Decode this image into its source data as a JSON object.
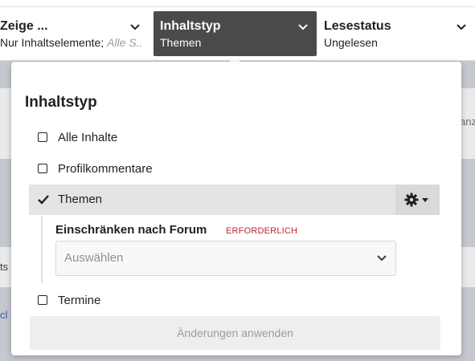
{
  "filters": [
    {
      "title": "Zeige ...",
      "value_main": "Nur Inhaltselemente;",
      "value_muted": "Alle S..."
    },
    {
      "title": "Inhaltstyp",
      "value": "Themen"
    },
    {
      "title": "Lesestatus",
      "value": "Ungelesen"
    }
  ],
  "popover": {
    "title": "Inhaltstyp",
    "options": [
      {
        "label": "Alle Inhalte",
        "checked": false
      },
      {
        "label": "Profilkommentare",
        "checked": false
      },
      {
        "label": "Themen",
        "checked": true
      },
      {
        "label": "Termine",
        "checked": false
      }
    ],
    "settings_icon": "gear-icon",
    "restrict_label": "Einschränken nach Forum",
    "required_label": "ERFORDERLICH",
    "forum_select_placeholder": "Auswählen",
    "apply_label": "Änderungen anwenden"
  },
  "background": {
    "fragment_right": "anz",
    "fragment_left": "ts",
    "fragment_left2": "cl"
  },
  "colors": {
    "active_filter_bg": "#4a4a4a",
    "required": "#c1272d",
    "selected_row": "#e4e4e4"
  }
}
